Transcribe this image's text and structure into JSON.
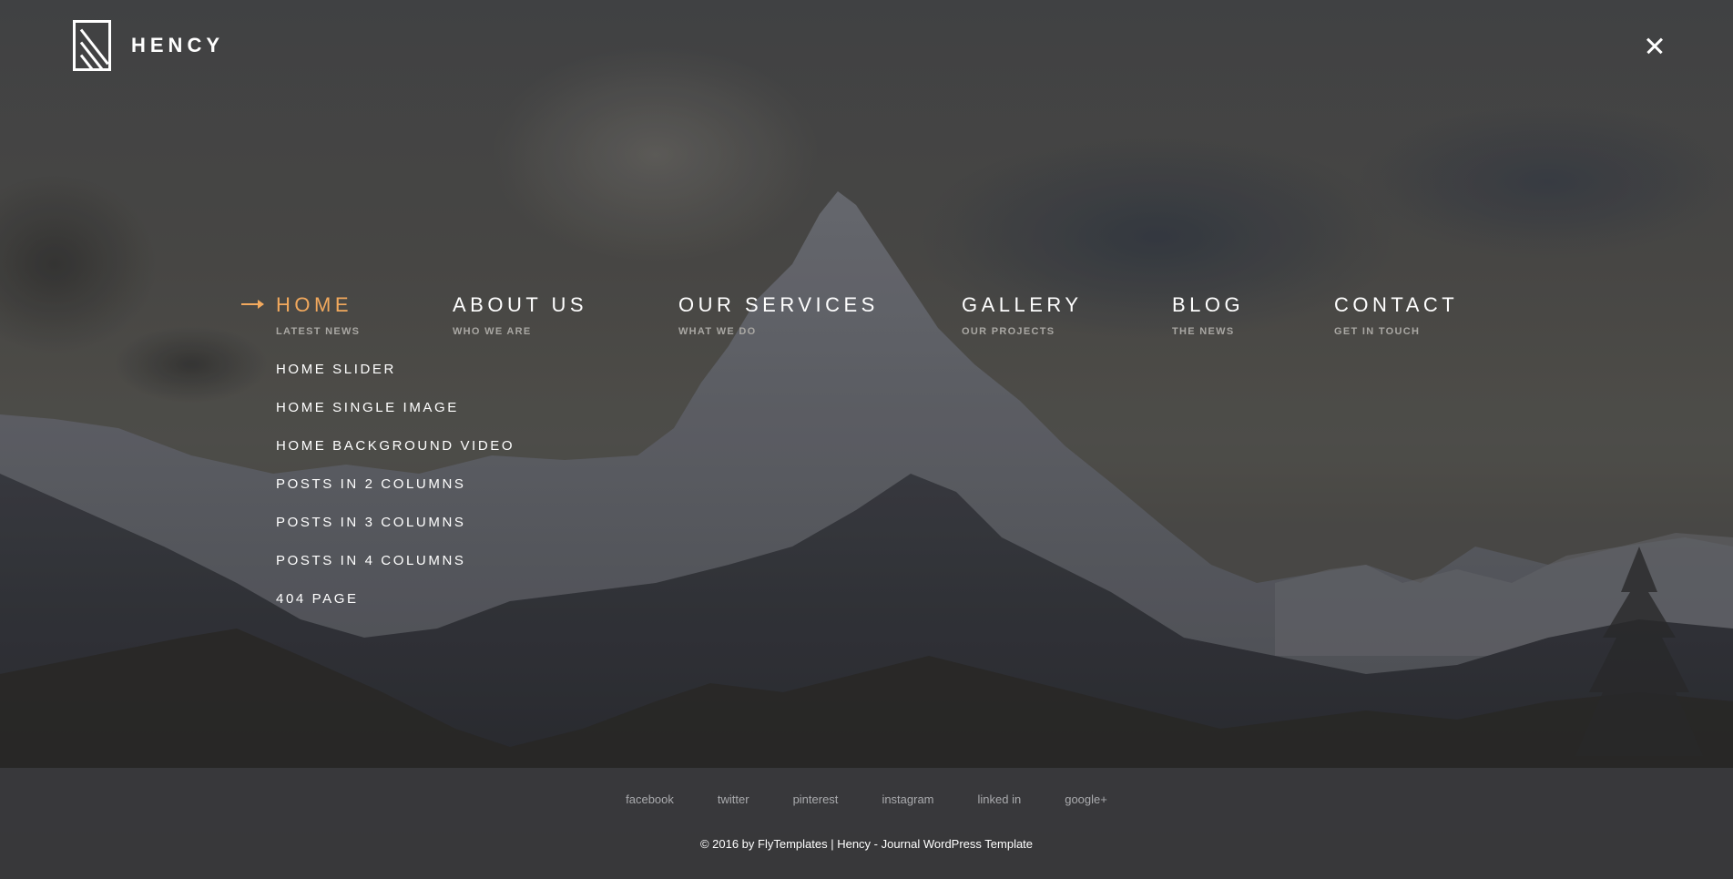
{
  "brand": {
    "name": "HENCY",
    "logo_icon": "hency-logo-icon"
  },
  "header": {
    "close_icon": "close-icon",
    "close_label": "Close menu"
  },
  "colors": {
    "accent": "#f2a95d",
    "text": "#ffffff",
    "subtext": "#a9a7a3",
    "footer_link": "#a9aaad"
  },
  "menu": {
    "items": [
      {
        "label": "HOME",
        "sub": "LATEST NEWS",
        "active": true
      },
      {
        "label": "ABOUT US",
        "sub": "WHO WE ARE",
        "active": false
      },
      {
        "label": "OUR SERVICES",
        "sub": "WHAT WE DO",
        "active": false
      },
      {
        "label": "GALLERY",
        "sub": "OUR PROJECTS",
        "active": false
      },
      {
        "label": "BLOG",
        "sub": "THE NEWS",
        "active": false
      },
      {
        "label": "CONTACT",
        "sub": "GET IN TOUCH",
        "active": false
      }
    ],
    "active_indicator_icon": "arrow-right-icon",
    "home_submenu": [
      "HOME SLIDER",
      "HOME SINGLE IMAGE",
      "HOME BACKGROUND VIDEO",
      "POSTS IN 2 COLUMNS",
      "POSTS IN 3 COLUMNS",
      "POSTS IN 4 COLUMNS",
      "404 PAGE"
    ]
  },
  "footer": {
    "social": [
      "facebook",
      "twitter",
      "pinterest",
      "instagram",
      "linked in",
      "google+"
    ],
    "copyright": "© 2016 by FlyTemplates | Hency - Journal WordPress Template"
  }
}
